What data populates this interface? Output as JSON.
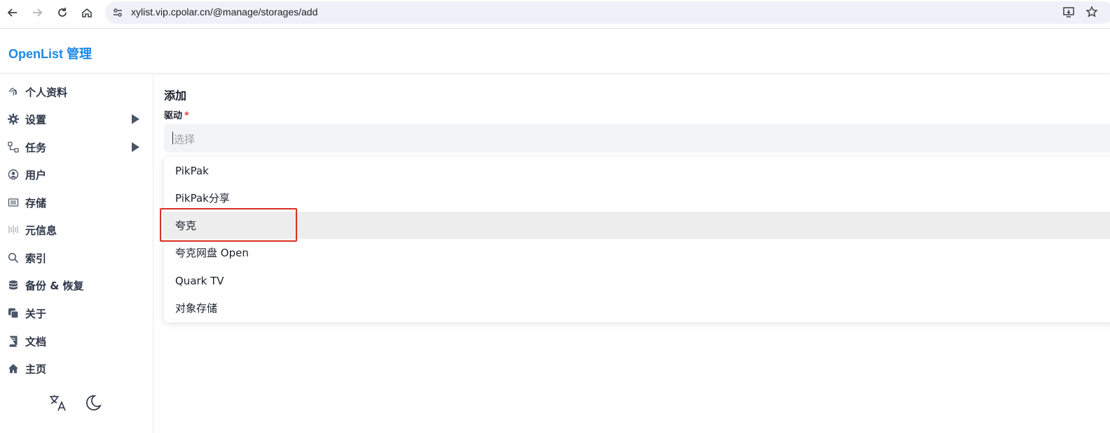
{
  "browser": {
    "url": "xylist.vip.cpolar.cn/@manage/storages/add",
    "icons": [
      "back-arrow-icon",
      "forward-arrow-icon",
      "reload-icon",
      "home-icon",
      "site-settings-icon",
      "install-app-icon",
      "bookmark-star-icon"
    ]
  },
  "header": {
    "title": "OpenList 管理"
  },
  "sidebar": {
    "items": [
      {
        "label": "个人资料",
        "icon": "fingerprint-icon"
      },
      {
        "label": "设置",
        "icon": "gear-icon",
        "expandable": true
      },
      {
        "label": "任务",
        "icon": "tasks-icon",
        "expandable": true
      },
      {
        "label": "用户",
        "icon": "user-circle-icon"
      },
      {
        "label": "存储",
        "icon": "storage-icon"
      },
      {
        "label": "元信息",
        "icon": "metadata-icon"
      },
      {
        "label": "索引",
        "icon": "search-icon"
      },
      {
        "label": "备份 & 恢复",
        "icon": "database-icon"
      },
      {
        "label": "关于",
        "icon": "copy-icon"
      },
      {
        "label": "文档",
        "icon": "book-icon"
      },
      {
        "label": "主页",
        "icon": "home-icon"
      }
    ],
    "bottom_icons": [
      "translate-icon",
      "moon-icon"
    ]
  },
  "main": {
    "title": "添加",
    "driver_label": "驱动",
    "required_mark": "*",
    "select_placeholder": "选择",
    "options": [
      "PikPak",
      "PikPak分享",
      "夸克",
      "夸克网盘 Open",
      "Quark TV",
      "对象存储"
    ],
    "highlighted_option": "夸克"
  },
  "colors": {
    "brand": "#1e88e5",
    "required": "#e53e3e",
    "annotation_box": "#d93025"
  }
}
